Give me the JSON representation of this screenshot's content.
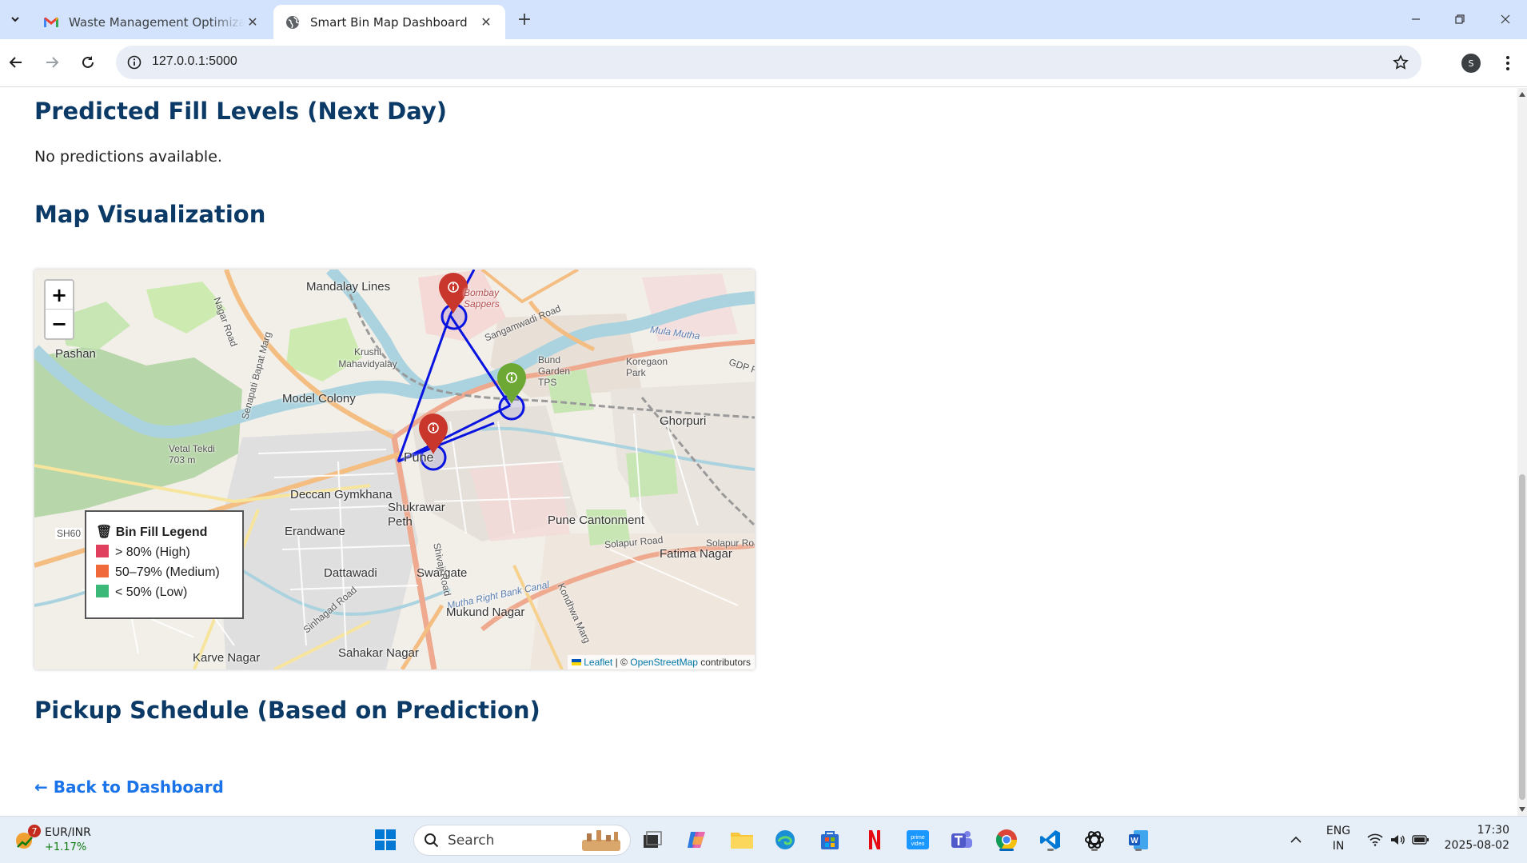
{
  "browser": {
    "tabs": [
      {
        "title": "Waste Management Optimizati",
        "favicon": "gmail-icon",
        "active": false
      },
      {
        "title": "Smart Bin Map Dashboard",
        "favicon": "globe-icon",
        "active": true
      }
    ],
    "url": "127.0.0.1:5000",
    "profile_initial": "S"
  },
  "page": {
    "predicted_heading": "Predicted Fill Levels (Next Day)",
    "no_predictions_text": "No predictions available.",
    "map_heading": "Map Visualization",
    "pickup_heading": "Pickup Schedule (Based on Prediction)",
    "back_link": "← Back to Dashboard"
  },
  "map": {
    "zoom_in": "+",
    "zoom_out": "−",
    "legend": {
      "title": "🗑 Bin Fill Legend",
      "items": [
        {
          "label": "> 80% (High)",
          "color": "#e0405e"
        },
        {
          "label": "50–79% (Medium)",
          "color": "#f0693a"
        },
        {
          "label": "< 50% (Low)",
          "color": "#3cb878"
        }
      ]
    },
    "attribution": {
      "leaflet": "Leaflet",
      "sep": "| ©",
      "osm": "OpenStreetMap",
      "tail": "contributors"
    },
    "markers": [
      {
        "color": "#c9372c",
        "label": "bin-marker-north"
      },
      {
        "color": "#6ea834",
        "label": "bin-marker-east"
      },
      {
        "color": "#c9372c",
        "label": "bin-marker-center"
      }
    ],
    "route_color": "#0a14e0",
    "place_labels": {
      "mandalay": "Mandalay Lines",
      "bombay": "Bombay Sappers",
      "sangamwadi": "Sangamwadi Road",
      "mula_mutha": "Mula Mutha",
      "pashan": "Pashan",
      "krushi": "Krushi Mahavidyalay",
      "bund_garden": "Bund Garden TPS",
      "koregaon": "Koregaon Park",
      "gdp": "GDP Ro",
      "model_colony": "Model Colony",
      "ghorpuri": "Ghorpuri",
      "vetal": "Vetal Tekdi 703 m",
      "pune": "Pune",
      "deccan": "Deccan Gymkhana",
      "shukrawar": "Shukrawar Peth",
      "pune_cantonment": "Pune Cantonment",
      "sh60": "SH60",
      "erandwane": "Erandwane",
      "solapur_road": "Solapur Road",
      "solapur_road2": "Solapur Roa",
      "fatima": "Fatima Nagar",
      "dattawadi": "Dattawadi",
      "swargate": "Swargate",
      "mutha_canal": "Mutha Right Bank Canal",
      "mukund": "Mukund Nagar",
      "karve": "Karve Nagar",
      "sahakar": "Sahakar Nagar",
      "senapati": "Senapati Bapat Marg",
      "nagar_road": "Nagar Road",
      "shivaji": "Shivaji Road",
      "kondhwa": "Kondhwa Marg",
      "sinhagad": "Sinhagad Road"
    }
  },
  "taskbar": {
    "weather": {
      "badge": "7",
      "line1": "EUR/INR",
      "line2": "+1.17%"
    },
    "search_placeholder": "Search",
    "lang": {
      "l1": "ENG",
      "l2": "IN"
    },
    "clock": {
      "time": "17:30",
      "date": "2025-08-02"
    }
  }
}
